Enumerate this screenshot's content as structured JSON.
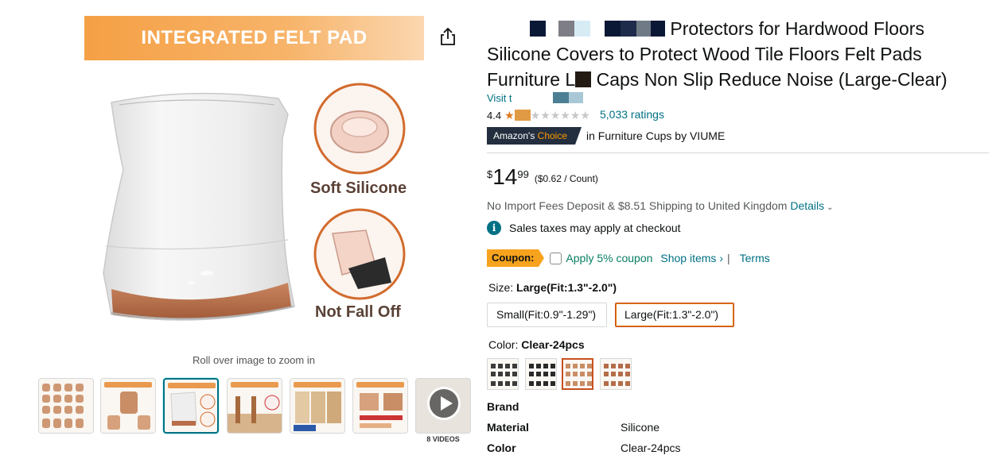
{
  "gallery": {
    "banner_text": "INTEGRATED FELT PAD",
    "callouts": [
      "Soft Silicone",
      "Not Fall Off"
    ],
    "zoom_hint": "Roll over image to zoom in",
    "thumbnail_captions": [
      "",
      "FIT VARIOUS SHAPES",
      "INTEGRATED FELT PAD",
      "PROTECT YOUR FLOORS",
      "LARGE-APPLICABLE SIZE",
      "EASY TO INSTALL"
    ],
    "videos_count": "8 VIDEOS",
    "active_thumbnail": 3
  },
  "product": {
    "title_line1_visible": "Protectors for Hardwood Floors",
    "title_line2_start": "Silicone",
    "title_line2_mid": "Covers",
    "title_line2_end": "to Protect Wood Tile Floors Felt Pads",
    "title_line3_start": "Furniture L",
    "title_line3_end": "Caps Non Slip Reduce Noise (Large-Clear)",
    "store_link": "Visit t",
    "rating_value": "4.4",
    "ratings_count": "5,033 ratings",
    "choice_badge_prefix": "Amazon's",
    "choice_badge_suffix": "Choice",
    "choice_category": "in Furniture Cups by VIUME"
  },
  "price": {
    "symbol": "$",
    "whole": "14",
    "fraction": "99",
    "unit_price": "($0.62 / Count)"
  },
  "shipping": {
    "text": "No Import Fees Deposit & $8.51 Shipping to United Kingdom",
    "details_link": "Details"
  },
  "tax_notice": "Sales taxes may apply at checkout",
  "coupon": {
    "badge": "Coupon:",
    "apply_label": "Apply 5% coupon",
    "shop_items": "Shop items ›",
    "separator": "|",
    "terms": "Terms"
  },
  "size": {
    "label": "Size:",
    "selected": "Large(Fit:1.3\"-2.0\")",
    "options": [
      "Small(Fit:0.9\"-1.29\")",
      "Large(Fit:1.3\"-2.0\")"
    ]
  },
  "color": {
    "label": "Color:",
    "selected": "Clear-24pcs",
    "swatch_count": 4,
    "selected_index": 2
  },
  "specs": [
    {
      "key": "Brand",
      "value": ""
    },
    {
      "key": "Material",
      "value": "Silicone"
    },
    {
      "key": "Color",
      "value": "Clear-24pcs"
    }
  ],
  "colors": {
    "link": "#007185",
    "star": "#de7921",
    "badge_dark": "#232f3e",
    "coupon": "#f7a31e",
    "selected_border": "#c7511f"
  }
}
